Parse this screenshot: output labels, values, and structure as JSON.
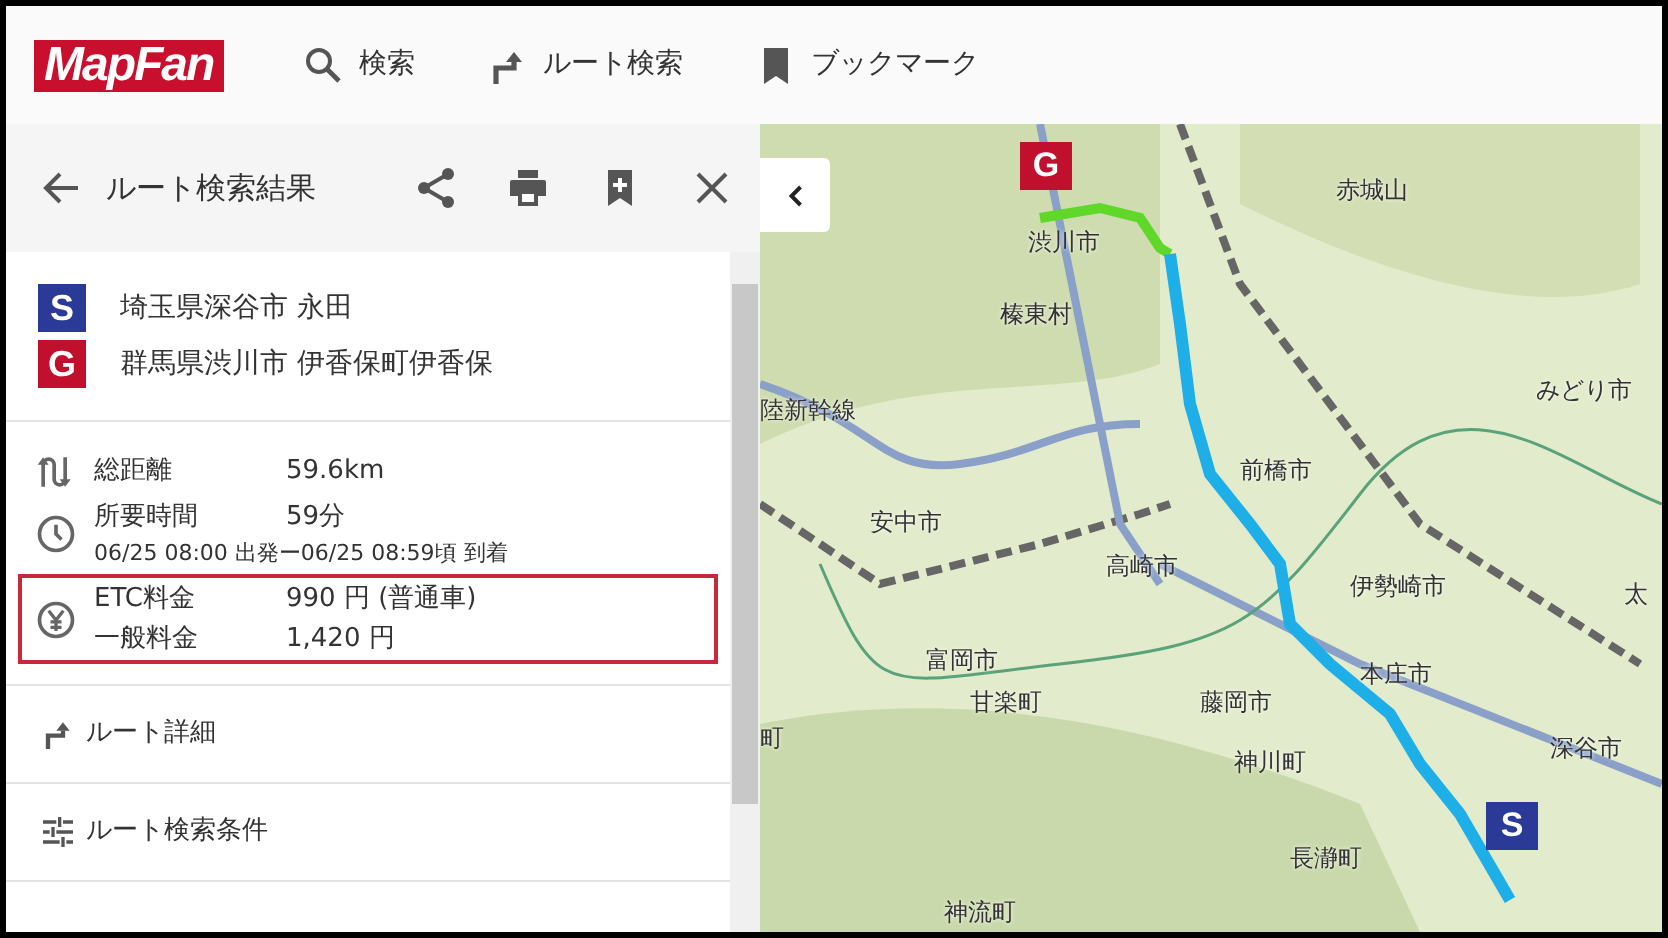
{
  "header": {
    "logo": "MapFan",
    "nav": [
      {
        "kind": "search",
        "label": "検索"
      },
      {
        "kind": "turn",
        "label": "ルート検索"
      },
      {
        "kind": "bookmark",
        "label": "ブックマーク"
      }
    ]
  },
  "panel": {
    "title": "ルート検索結果",
    "points": [
      {
        "kind": "start",
        "mark": "S",
        "name": "埼玉県深谷市 永田"
      },
      {
        "kind": "goal",
        "mark": "G",
        "name": "群馬県渋川市 伊香保町伊香保"
      }
    ],
    "distance": {
      "label": "総距離",
      "value": "59.6km"
    },
    "duration": {
      "label": "所要時間",
      "value": "59分",
      "detail": "06/25 08:00 出発ー06/25 08:59頃 到着"
    },
    "fees": {
      "highlighted": true,
      "rows": [
        {
          "label": "ETC料金",
          "value": "990 円 (普通車)"
        },
        {
          "label": "一般料金",
          "value": "1,420 円"
        }
      ]
    },
    "links": [
      {
        "kind": "turn",
        "label": "ルート詳細"
      },
      {
        "kind": "tune",
        "label": "ルート検索条件"
      }
    ]
  },
  "map": {
    "markers": [
      {
        "kind": "goal",
        "mark": "G"
      },
      {
        "kind": "start",
        "mark": "S"
      }
    ],
    "labels": [
      "赤城山",
      "渋川市",
      "榛東村",
      "陸新幹線",
      "みどり市",
      "前橋市",
      "安中市",
      "高崎市",
      "伊勢崎市",
      "太",
      "富岡市",
      "甘楽町",
      "藤岡市",
      "本庄市",
      "町",
      "深谷市",
      "神川町",
      "長瀞町",
      "神流町"
    ]
  }
}
